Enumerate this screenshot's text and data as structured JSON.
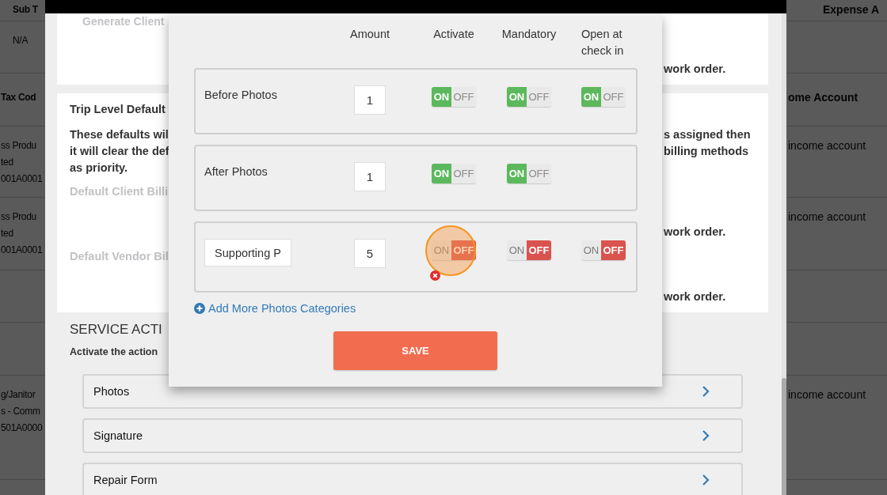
{
  "background_table": {
    "left_column": [
      {
        "kind": "header",
        "lines": [
          "Sub T"
        ]
      },
      {
        "kind": "cell",
        "lines": [
          "N/A"
        ]
      },
      {
        "kind": "header",
        "lines": [
          "Tax Cod"
        ]
      },
      {
        "kind": "cell",
        "lines": [
          "ss Produ",
          "ted",
          "001A0001"
        ]
      },
      {
        "kind": "cell",
        "lines": [
          "ss Produ",
          "ted",
          "001A0001"
        ]
      },
      {
        "kind": "empty"
      },
      {
        "kind": "empty"
      },
      {
        "kind": "cell",
        "lines": [
          "g/Janitor",
          "s - Comm",
          "501A0000"
        ]
      },
      {
        "kind": "empty"
      }
    ],
    "right_column": [
      {
        "kind": "header",
        "lines": [
          "Expense A"
        ]
      },
      {
        "kind": "empty"
      },
      {
        "kind": "header",
        "lines": [
          "ome Account"
        ]
      },
      {
        "kind": "cell",
        "lines": [
          "income account"
        ]
      },
      {
        "kind": "cell",
        "lines": [
          "income account"
        ]
      },
      {
        "kind": "empty"
      },
      {
        "kind": "empty"
      },
      {
        "kind": "cell",
        "lines": [
          "income account"
        ]
      },
      {
        "kind": "empty"
      }
    ]
  },
  "panel": {
    "client_card": {
      "label": "Generate Client",
      "note": "work order."
    },
    "trip_card": {
      "title": "Trip Level Default",
      "description_left": [
        "These defaults wil",
        "it will clear the def",
        "as priority."
      ],
      "description_right": [
        "s assigned then",
        "billing methods"
      ],
      "client_billing_label": "Default Client Billi",
      "client_note": "work order.",
      "vendor_billing_label": "Default Vendor Bil",
      "vendor_note": "work order."
    },
    "section_title": "SERVICE ACTI",
    "section_hint": "Activate the action",
    "service_actions": [
      {
        "label": "Photos"
      },
      {
        "label": "Signature"
      },
      {
        "label": "Repair Form"
      }
    ]
  },
  "modal": {
    "columns": [
      "Amount",
      "Activate",
      "Mandatory",
      "Open at check in"
    ],
    "categories": [
      {
        "kind": "fixed",
        "name": "Before Photos",
        "amount": "1",
        "activate": {
          "on": true,
          "on_text": "ON",
          "off_text": "OFF"
        },
        "mandatory": {
          "on": true,
          "on_text": "ON",
          "off_text": "OFF"
        },
        "open_at_check_in": {
          "on": true,
          "on_text": "ON",
          "off_text": "OFF"
        }
      },
      {
        "kind": "fixed",
        "name": "After Photos",
        "amount": "1",
        "activate": {
          "on": true,
          "on_text": "ON",
          "off_text": "OFF"
        },
        "mandatory": {
          "on": true,
          "on_text": "ON",
          "off_text": "OFF"
        }
      },
      {
        "kind": "custom",
        "name": "Supporting P",
        "amount": "5",
        "activate": {
          "on": false,
          "clicked": true,
          "error": true,
          "on_text": "ON",
          "off_text": "OFF"
        },
        "mandatory": {
          "on": false,
          "on_text": "ON",
          "off_text": "OFF"
        },
        "open_at_check_in": {
          "on": false,
          "on_text": "ON",
          "off_text": "OFF"
        }
      }
    ],
    "add_link": "Add More Photos Categories",
    "save_button": "SAVE"
  }
}
